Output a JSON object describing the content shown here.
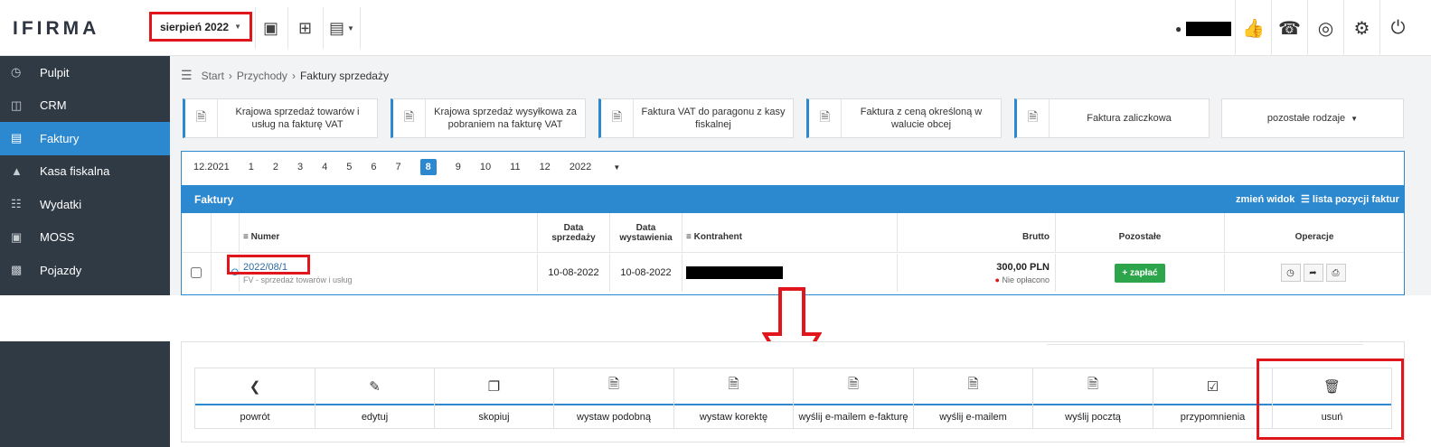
{
  "topbar": {
    "logo": "IFIRMA",
    "month_selector": "sierpień 2022"
  },
  "sidebar": {
    "items": [
      {
        "label": "Pulpit",
        "icon": "dashboard-icon"
      },
      {
        "label": "CRM",
        "icon": "crm-icon"
      },
      {
        "label": "Faktury",
        "icon": "invoice-icon",
        "active": true
      },
      {
        "label": "Kasa fiskalna",
        "icon": "cash-register-icon"
      },
      {
        "label": "Wydatki",
        "icon": "expenses-icon"
      },
      {
        "label": "MOSS",
        "icon": "moss-icon"
      },
      {
        "label": "Pojazdy",
        "icon": "car-icon"
      }
    ]
  },
  "breadcrumb": {
    "items": [
      "Start",
      "Przychody",
      "Faktury sprzedaży"
    ]
  },
  "doc_types": [
    "Krajowa sprzedaż towarów i usług na fakturę VAT",
    "Krajowa sprzedaż wysyłkowa za pobraniem na fakturę VAT",
    "Faktura VAT do paragonu z kasy fiskalnej",
    "Faktura z ceną określoną w walucie obcej",
    "Faktura zaliczkowa"
  ],
  "other_types": "pozostałe rodzaje",
  "months": [
    "12.2021",
    "1",
    "2",
    "3",
    "4",
    "5",
    "6",
    "7",
    "8",
    "9",
    "10",
    "11",
    "12",
    "2022"
  ],
  "months_active": "8",
  "faktury": {
    "title": "Faktury",
    "change_view": "zmień widok",
    "item_list": "lista pozycji faktur"
  },
  "table": {
    "headers": {
      "numer": "Numer",
      "data_sprzedazy": "Data sprzedaży",
      "data_wystawienia": "Data wystawienia",
      "kontrahent": "Kontrahent",
      "brutto": "Brutto",
      "pozostale": "Pozostałe",
      "operacje": "Operacje"
    },
    "row": {
      "numer": "2022/08/1",
      "subtitle": "FV - sprzedaż towarów i usług",
      "data_sprzedazy": "10-08-2022",
      "data_wystawienia": "10-08-2022",
      "brutto": "300,00 PLN",
      "status": "Nie opłacono",
      "pay_button": "+ zapłać"
    }
  },
  "actions": [
    {
      "label": "powrót",
      "icon": "back-icon"
    },
    {
      "label": "edytuj",
      "icon": "edit-icon"
    },
    {
      "label": "skopiuj",
      "icon": "copy-icon"
    },
    {
      "label": "wystaw podobną",
      "icon": "similar-doc-icon"
    },
    {
      "label": "wystaw korektę",
      "icon": "correction-doc-icon"
    },
    {
      "label": "wyślij e-mailem e-fakturę",
      "icon": "e-invoice-icon"
    },
    {
      "label": "wyślij e-mailem",
      "icon": "email-doc-icon"
    },
    {
      "label": "wyślij pocztą",
      "icon": "mail-doc-icon"
    },
    {
      "label": "przypomnienia",
      "icon": "reminder-icon"
    },
    {
      "label": "usuń",
      "icon": "trash-icon"
    }
  ],
  "colors": {
    "accent": "#2c88cf",
    "sidebar": "#2f3a45",
    "highlight": "#e0161c",
    "pay": "#2ca54b"
  }
}
